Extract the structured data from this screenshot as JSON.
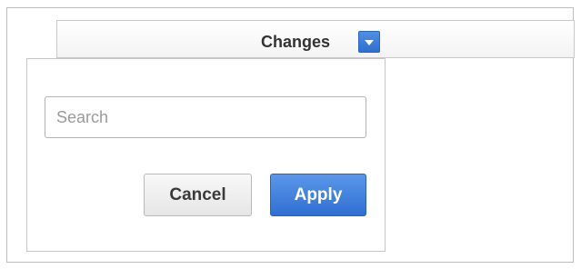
{
  "column": {
    "title": "Changes",
    "toggle_icon": "chevron-down-icon"
  },
  "filter_popup": {
    "search": {
      "placeholder": "Search",
      "value": ""
    },
    "cancel_label": "Cancel",
    "apply_label": "Apply"
  },
  "colors": {
    "accent": "#2f6fd1",
    "border": "#bdbdbd"
  }
}
